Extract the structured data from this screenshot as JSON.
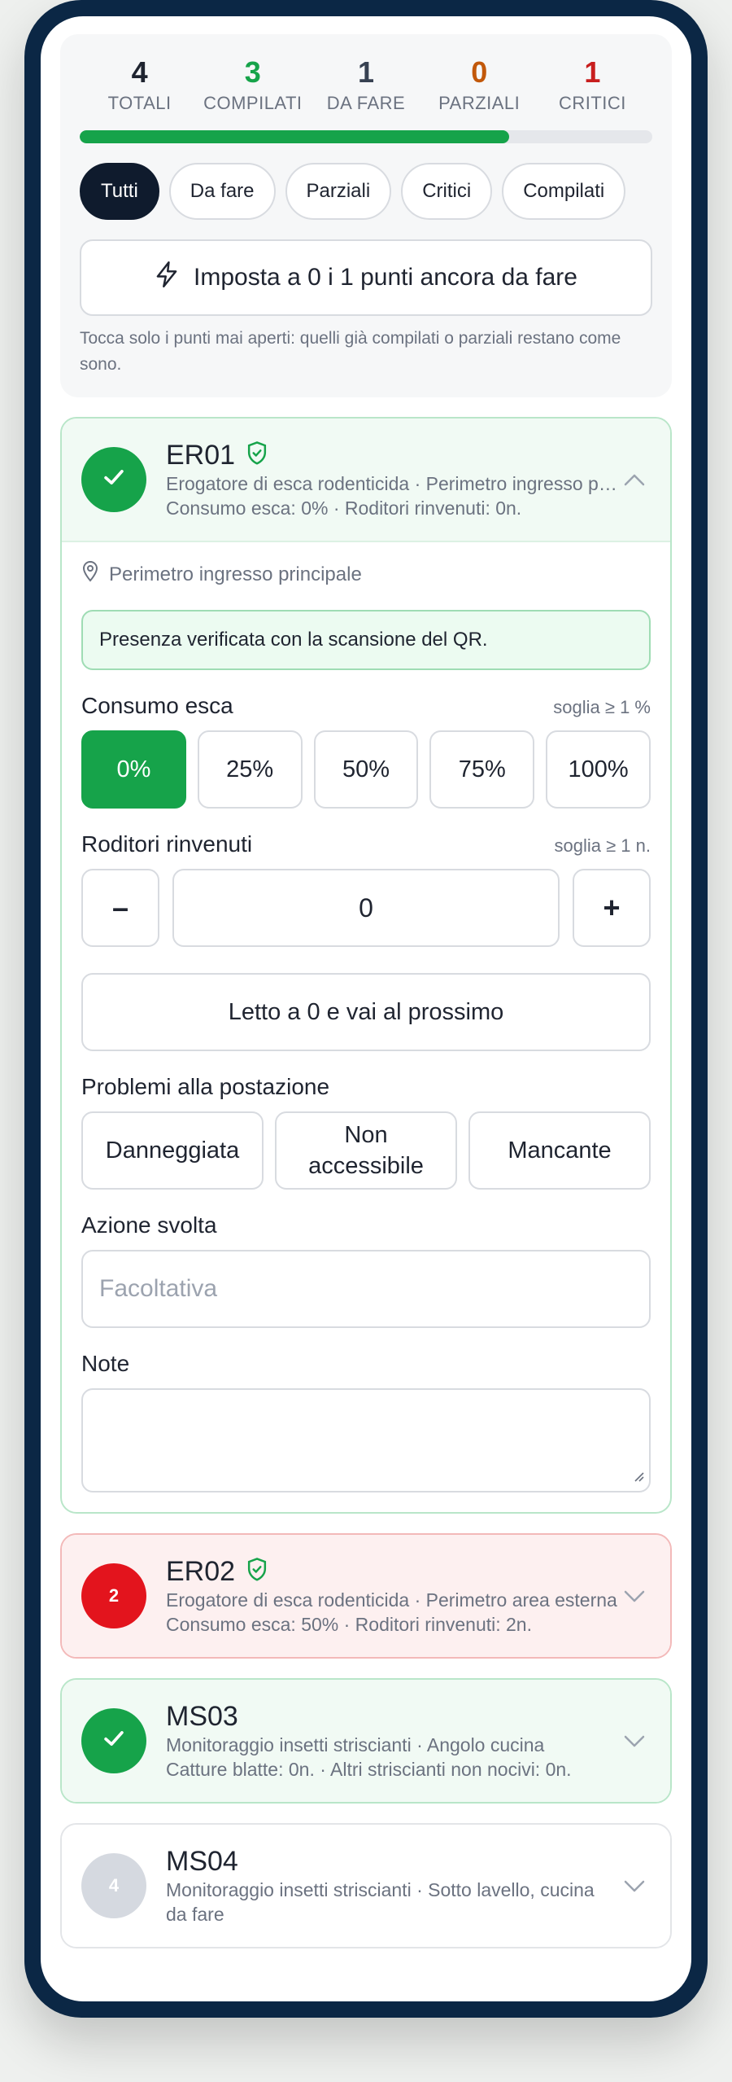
{
  "summary": {
    "stats": [
      {
        "value": "4",
        "label": "TOTALI"
      },
      {
        "value": "3",
        "label": "COMPILATI"
      },
      {
        "value": "1",
        "label": "DA FARE"
      },
      {
        "value": "0",
        "label": "PARZIALI"
      },
      {
        "value": "1",
        "label": "CRITICI"
      }
    ],
    "progress_fraction": 0.75,
    "filters": [
      "Tutti",
      "Da fare",
      "Parziali",
      "Critici",
      "Compilati"
    ],
    "active_filter": "Tutti",
    "bulk_button_label": "Imposta a 0 i 1 punti ancora da fare",
    "bulk_hint": "Tocca solo i punti mai aperti: quelli già compilati o parziali restano come sono."
  },
  "points": [
    {
      "code": "ER01",
      "line1": "Erogatore di esca rodenticida · Perimetro ingresso principale",
      "line2": "Consumo esca: 0% · Roditori rinvenuti: 0n.",
      "status": "done"
    },
    {
      "code": "ER02",
      "badge": "2",
      "line1": "Erogatore di esca rodenticida · Perimetro area esterna",
      "line2": "Consumo esca: 50% · Roditori rinvenuti: 2n.",
      "status": "critical"
    },
    {
      "code": "MS03",
      "line1": "Monitoraggio insetti striscianti · Angolo cucina",
      "line2": "Catture blatte: 0n. · Altri striscianti non nocivi: 0n.",
      "status": "done"
    },
    {
      "code": "MS04",
      "badge": "4",
      "line1": "Monitoraggio insetti striscianti · Sotto lavello, cucina",
      "line2": "da fare",
      "status": "todo"
    }
  ],
  "detail": {
    "location": "Perimetro ingresso principale",
    "verified_text": "Presenza verificata con la scansione del QR.",
    "bait": {
      "label": "Consumo esca",
      "threshold": "soglia ≥ 1 %",
      "options": [
        "0%",
        "25%",
        "50%",
        "75%",
        "100%"
      ],
      "selected": "0%"
    },
    "rodents": {
      "label": "Roditori rinvenuti",
      "threshold": "soglia ≥ 1 n.",
      "minus": "–",
      "value": "0",
      "plus": "+"
    },
    "next_button": "Letto a 0 e vai al prossimo",
    "problems": {
      "label": "Problemi alla postazione",
      "options": [
        "Danneggiata",
        "Non accessibile",
        "Mancante"
      ]
    },
    "action": {
      "label": "Azione svolta",
      "placeholder": "Facoltativa"
    },
    "notes": {
      "label": "Note"
    }
  },
  "colors": {
    "accent_green": "#16a34a",
    "critical_red": "#e3141d",
    "partial_orange": "#c2580a",
    "dark": "#0f1b2d"
  }
}
